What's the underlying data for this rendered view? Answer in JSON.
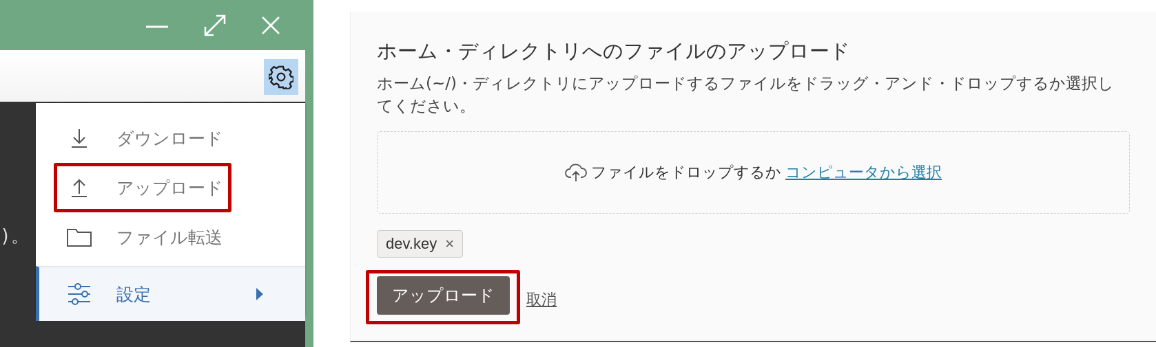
{
  "terminal": {
    "text_fragment": ")。"
  },
  "menu": {
    "items": [
      {
        "kind": "download",
        "label": "ダウンロード",
        "selected": false,
        "highlighted": false,
        "has_submenu": false
      },
      {
        "kind": "upload",
        "label": "アップロード",
        "selected": false,
        "highlighted": true,
        "has_submenu": false
      },
      {
        "kind": "folder",
        "label": "ファイル転送",
        "selected": false,
        "highlighted": false,
        "has_submenu": false
      },
      {
        "kind": "settings",
        "label": "設定",
        "selected": true,
        "highlighted": false,
        "has_submenu": true
      }
    ]
  },
  "upload_dialog": {
    "title": "ホーム・ディレクトリへのファイルのアップロード",
    "description": "ホーム(~/)・ディレクトリにアップロードするファイルをドラッグ・アンド・ドロップするか選択してください。",
    "drop_zone": {
      "text": "ファイルをドロップするか",
      "link": "コンピュータから選択"
    },
    "files": [
      {
        "name": "dev.key",
        "remove": "×"
      }
    ],
    "buttons": [
      {
        "kind": "primary",
        "label": "アップロード",
        "highlighted": true
      },
      {
        "kind": "link",
        "label": "取消",
        "highlighted": false
      }
    ]
  }
}
